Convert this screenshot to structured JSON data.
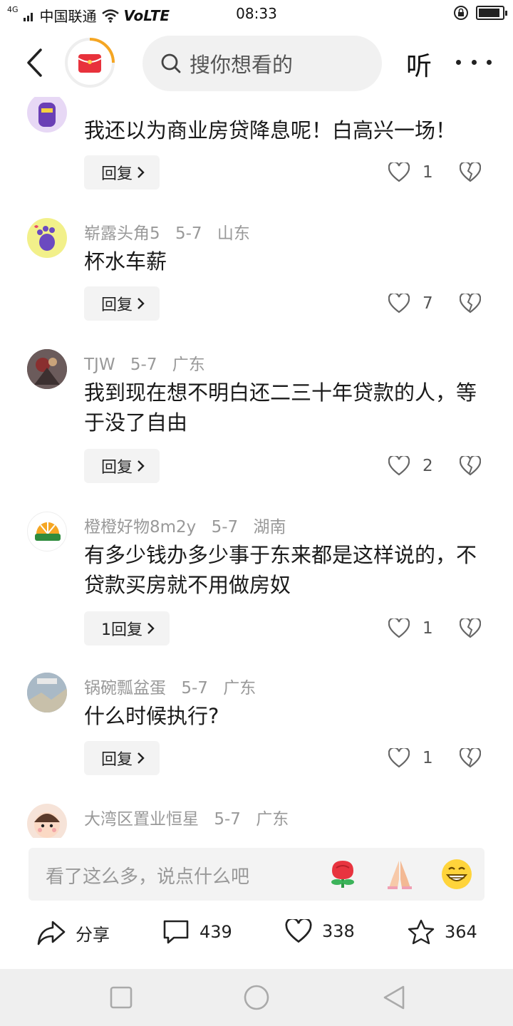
{
  "status_bar": {
    "signal": "4G",
    "carrier": "中国联通",
    "volte": "VoLTE",
    "time": "08:33",
    "battery_level": 0.9
  },
  "header": {
    "search_placeholder": "搜你想看的",
    "listen_label": "听",
    "icons": {
      "back": "back-arrow-icon",
      "search": "search-icon",
      "more": "more-dots-icon",
      "logo": "app-logo-icon"
    }
  },
  "comments": [
    {
      "name": "",
      "date": "",
      "region": "",
      "text": "我还以为商业房贷降息呢！白高兴一场！",
      "reply_label": "回复",
      "likes": "1"
    },
    {
      "name": "崭露头角5",
      "date": "5-7",
      "region": "山东",
      "text": "杯水车薪",
      "reply_label": "回复",
      "likes": "7"
    },
    {
      "name": "TJW",
      "date": "5-7",
      "region": "广东",
      "text": "我到现在想不明白还二三十年贷款的人，等于没了自由",
      "reply_label": "回复",
      "likes": "2"
    },
    {
      "name": "橙橙好物8m2y",
      "date": "5-7",
      "region": "湖南",
      "text": "有多少钱办多少事于东来都是这样说的，不贷款买房就不用做房奴",
      "reply_label": "1回复",
      "likes": "1"
    },
    {
      "name": "锅碗瓢盆蛋",
      "date": "5-7",
      "region": "广东",
      "text": "什么时候执行?",
      "reply_label": "回复",
      "likes": "1"
    },
    {
      "name": "大湾区置业恒星",
      "date": "5-7",
      "region": "广东",
      "text": "",
      "reply_label": "",
      "likes": ""
    }
  ],
  "input_bar": {
    "placeholder": "看了这么多，说点什么吧",
    "emojis": [
      "rose-icon",
      "praying-hands-icon",
      "grin-icon"
    ]
  },
  "actions": {
    "share_label": "分享",
    "comment_count": "439",
    "like_count": "338",
    "favorite_count": "364"
  },
  "colors": {
    "accent": "#e8323c",
    "logo_ring": "#f5a623",
    "muted": "#999999",
    "reply_bg": "#f3f3f3",
    "nav_bg": "#efefef"
  }
}
